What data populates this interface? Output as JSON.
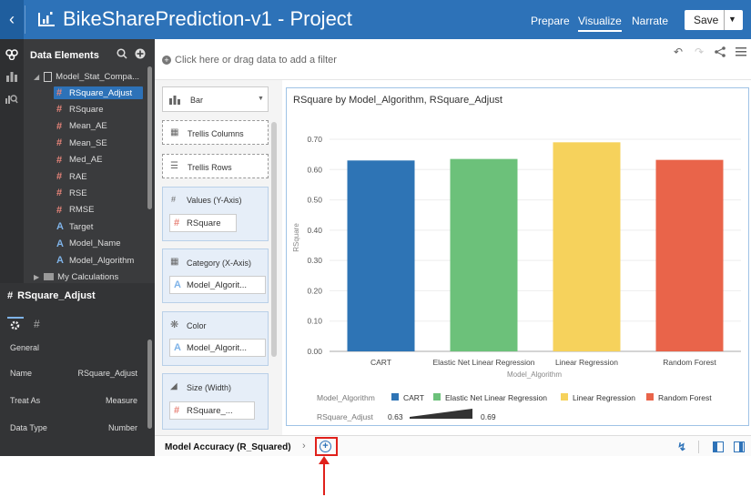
{
  "header": {
    "back_icon": "chevron-left-icon",
    "title": "BikeSharePrediction-v1 - Project",
    "nav": [
      "Prepare",
      "Visualize",
      "Narrate"
    ],
    "active_nav": "Visualize",
    "save_label": "Save"
  },
  "data_panel": {
    "title": "Data Elements",
    "source": "Model_Stat_Compa...",
    "items": [
      {
        "label": "RSquare_Adjust",
        "type": "measure",
        "selected": true
      },
      {
        "label": "RSquare",
        "type": "measure"
      },
      {
        "label": "Mean_AE",
        "type": "measure"
      },
      {
        "label": "Mean_SE",
        "type": "measure"
      },
      {
        "label": "Med_AE",
        "type": "measure"
      },
      {
        "label": "RAE",
        "type": "measure"
      },
      {
        "label": "RSE",
        "type": "measure"
      },
      {
        "label": "RMSE",
        "type": "measure"
      },
      {
        "label": "Target",
        "type": "attribute"
      },
      {
        "label": "Model_Name",
        "type": "attribute"
      },
      {
        "label": "Model_Algorithm",
        "type": "attribute"
      }
    ],
    "folder": "My Calculations"
  },
  "properties": {
    "title": "RSquare_Adjust",
    "section": "General",
    "rows": [
      {
        "label": "Name",
        "value": "RSquare_Adjust"
      },
      {
        "label": "Treat As",
        "value": "Measure"
      },
      {
        "label": "Data Type",
        "value": "Number"
      }
    ]
  },
  "filter_hint": "Click here or drag data to add a filter",
  "grammar": {
    "chart_type": "Bar",
    "trellis_columns": "Trellis Columns",
    "trellis_rows": "Trellis Rows",
    "values_label": "Values (Y-Axis)",
    "values_item": "RSquare",
    "category_label": "Category (X-Axis)",
    "category_item": "Model_Algorit...",
    "color_label": "Color",
    "color_item": "Model_Algorit...",
    "size_label": "Size (Width)",
    "size_item": "RSquare_..."
  },
  "legend": {
    "title": "Model_Algorithm",
    "size_title": "RSquare_Adjust",
    "size_min": "0.63",
    "size_max": "0.69"
  },
  "chart_data": {
    "type": "bar",
    "title": "RSquare by Model_Algorithm, RSquare_Adjust",
    "xlabel": "Model_Algorithm",
    "ylabel": "RSquare",
    "categories": [
      "CART",
      "Elastic Net Linear Regression",
      "Linear Regression",
      "Random Forest"
    ],
    "values": [
      0.63,
      0.635,
      0.69,
      0.632
    ],
    "colors": [
      "#2e74b5",
      "#6cc17a",
      "#f6d25c",
      "#e9644a"
    ],
    "yticks": [
      "0.00",
      "0.10",
      "0.20",
      "0.30",
      "0.40",
      "0.50",
      "0.60",
      "0.70"
    ],
    "ylim": [
      0,
      0.7
    ]
  },
  "footer": {
    "tab": "Model Accuracy (R_Squared)"
  }
}
